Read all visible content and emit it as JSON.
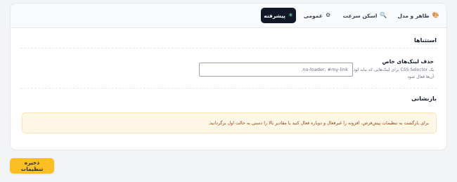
{
  "tabs": [
    {
      "label": "ظاهر و مدل",
      "icon": "🎨",
      "icon_name": "palette-icon",
      "active": false
    },
    {
      "label": "اسکن سرعت",
      "icon": "🔍",
      "icon_name": "search-icon",
      "active": false
    },
    {
      "label": "عمومی",
      "icon": "⚙",
      "icon_name": "gear-icon",
      "active": false
    },
    {
      "label": "پیشرفته",
      "icon": "✳",
      "icon_name": "sparkle-icon",
      "active": true
    }
  ],
  "exceptions": {
    "title": "استثناها",
    "field_label": "حذف لینک‌های خاص",
    "field_desc": "یک CSS Selector برای لینک‌هایی که نباید لودینگ روی آن‌ها فعال شود",
    "input_placeholder": "no-loader, #my-link."
  },
  "reset": {
    "title": "بازنشانی",
    "notice": "برای بازگشت به تنظیمات پیش‌فرض، افزونه را غیرفعال و دوباره فعال کنید یا مقادیر بالا را دستی به حالت اول برگردانید."
  },
  "footer": {
    "save_label": "ذخیره تنظیمات"
  },
  "colors": {
    "accent": "#fbbf24",
    "active_tab": "#111827",
    "notice_bg": "#fff7e6"
  }
}
